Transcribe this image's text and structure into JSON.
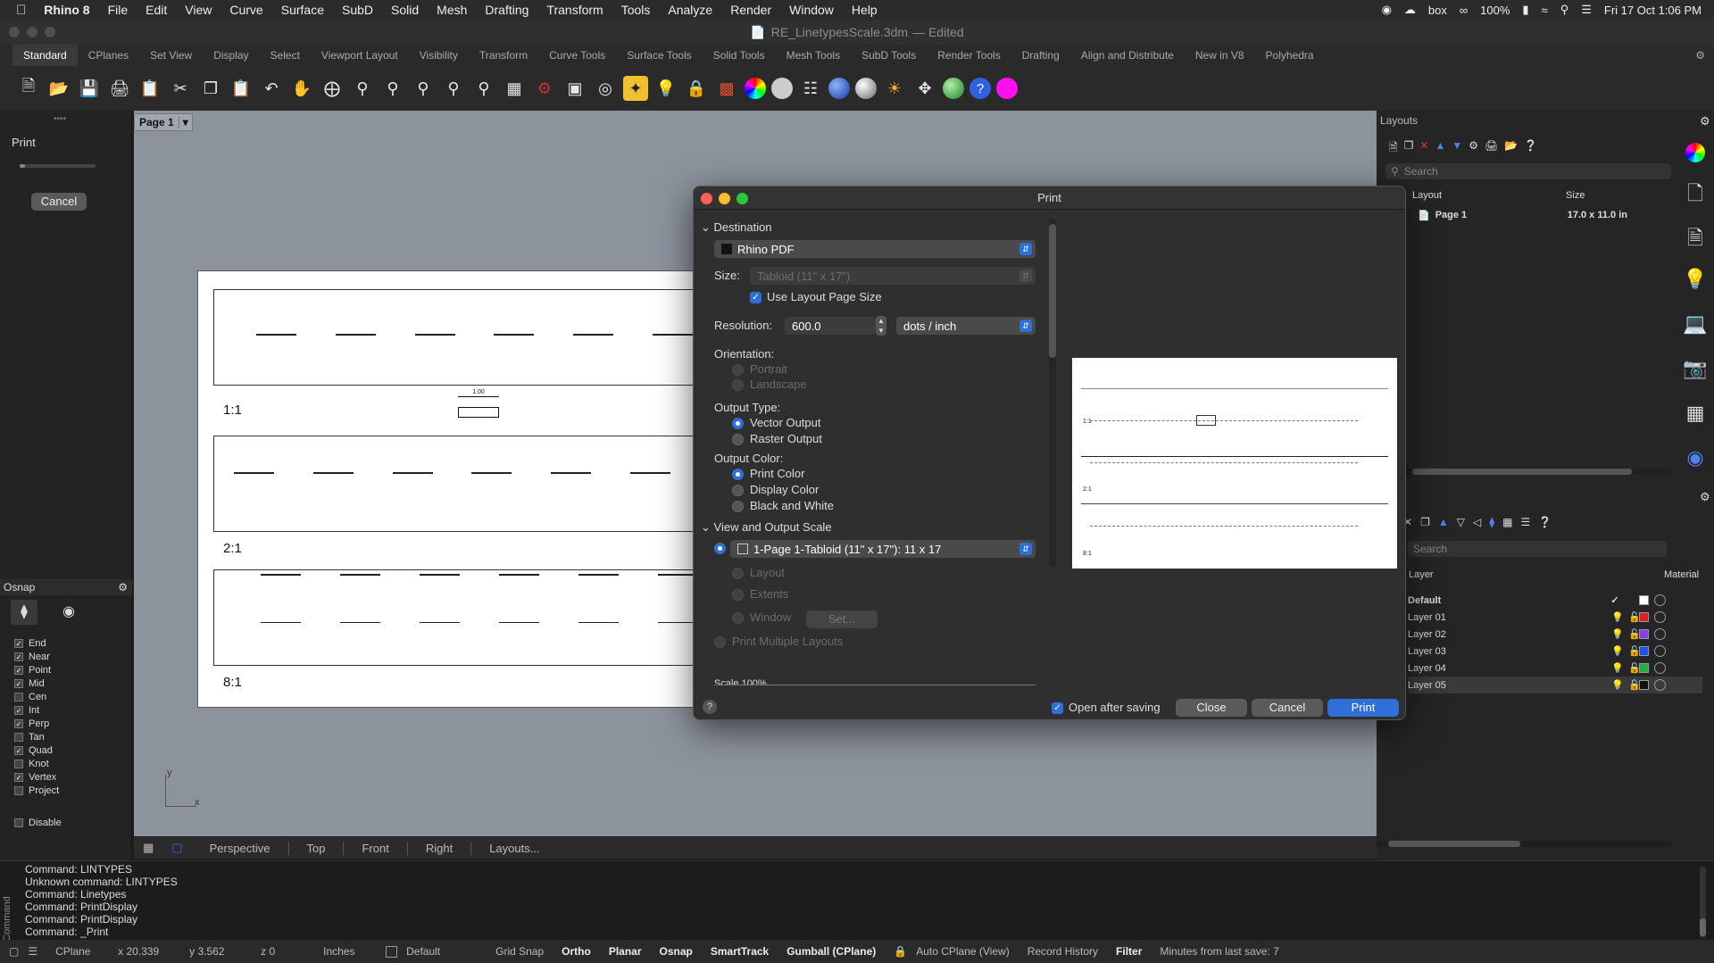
{
  "menubar": {
    "app_name": "Rhino 8",
    "items": [
      "File",
      "Edit",
      "View",
      "Curve",
      "Surface",
      "SubD",
      "Solid",
      "Mesh",
      "Drafting",
      "Transform",
      "Tools",
      "Analyze",
      "Render",
      "Window",
      "Help"
    ],
    "battery": "100%",
    "datetime": "Fri 17 Oct  1:06 PM"
  },
  "window": {
    "title": "RE_LinetypesScale.3dm",
    "edited": "— Edited"
  },
  "tabs": [
    "Standard",
    "CPlanes",
    "Set View",
    "Display",
    "Select",
    "Viewport Layout",
    "Visibility",
    "Transform",
    "Curve Tools",
    "Surface Tools",
    "Solid Tools",
    "Mesh Tools",
    "SubD Tools",
    "Render Tools",
    "Drafting",
    "Align and Distribute",
    "New in V8",
    "Polyhedra"
  ],
  "toolbar_icons": [
    "new-icon",
    "open-icon",
    "save-icon",
    "print-icon",
    "paste-special-icon",
    "cut-icon",
    "copy-icon",
    "paste-icon",
    "undo-icon",
    "pan-icon",
    "rotate-icon",
    "zoom-icon",
    "zoom-window-icon",
    "zoom-extents-icon",
    "zoom-selected-icon",
    "zoom-all-icon",
    "viewport-layout-icon",
    "car-icon",
    "plane-icon",
    "snap-icon",
    "object-snap-icon",
    "light-icon",
    "lock-icon",
    "properties-icon",
    "color-wheel-icon",
    "material-icon",
    "wireframe-icon",
    "shaded-icon",
    "rendered-icon",
    "sun-icon",
    "settings-icon",
    "transform-icon",
    "globe-icon",
    "help-icon",
    "magenta-icon"
  ],
  "left": {
    "print_label": "Print",
    "cancel_label": "Cancel",
    "osnap_title": "Osnap",
    "osnaps": [
      {
        "name": "End",
        "on": true
      },
      {
        "name": "Near",
        "on": true
      },
      {
        "name": "Point",
        "on": true
      },
      {
        "name": "Mid",
        "on": true
      },
      {
        "name": "Cen",
        "on": false
      },
      {
        "name": "Int",
        "on": true
      },
      {
        "name": "Perp",
        "on": true
      },
      {
        "name": "Tan",
        "on": false
      },
      {
        "name": "Quad",
        "on": true
      },
      {
        "name": "Knot",
        "on": false
      },
      {
        "name": "Vertex",
        "on": true
      },
      {
        "name": "Project",
        "on": false
      }
    ],
    "disable_label": "Disable"
  },
  "viewport": {
    "page_tab": "Page 1",
    "labels": [
      "1:1",
      "2:1",
      "8:1"
    ],
    "dimension": "1.00",
    "axis_x": "x",
    "axis_y": "y"
  },
  "view_tabs": [
    "Perspective",
    "Top",
    "Front",
    "Right",
    "Layouts..."
  ],
  "dialog": {
    "title": "Print",
    "destination_section": "Destination",
    "destination": "Rhino PDF",
    "size_label": "Size:",
    "size_value": "Tabloid (11\" x 17\")",
    "use_layout_size": "Use Layout Page Size",
    "resolution_label": "Resolution:",
    "resolution_value": "600.0",
    "resolution_unit": "dots / inch",
    "orientation_label": "Orientation:",
    "portrait": "Portrait",
    "landscape": "Landscape",
    "output_type_label": "Output Type:",
    "vector": "Vector Output",
    "raster": "Raster Output",
    "output_color_label": "Output Color:",
    "print_color": "Print Color",
    "display_color": "Display Color",
    "bw": "Black and White",
    "view_section": "View and Output Scale",
    "view_value": "1-Page 1-Tabloid (11\" x 17\"): 11 x 17",
    "layout": "Layout",
    "extents": "Extents",
    "window": "Window",
    "set_label": "Set...",
    "multiple_layouts": "Print Multiple Layouts",
    "scale_label": "Scale 100%",
    "open_after_saving": "Open after saving",
    "close_label": "Close",
    "cancel_label": "Cancel",
    "print_label": "Print",
    "preview_labels": [
      "1:1",
      "2:1",
      "8:1"
    ]
  },
  "layouts_panel": {
    "title": "Layouts",
    "search_placeholder": "Search",
    "col_layout": "Layout",
    "col_size": "Size",
    "rows": [
      {
        "name": "Page 1",
        "size": "17.0 x 11.0 in"
      }
    ]
  },
  "layers_panel": {
    "search_placeholder": "Search",
    "col_layer": "Layer",
    "col_material": "Material",
    "rows": [
      {
        "name": "Default",
        "color": "#ffffff",
        "current": true
      },
      {
        "name": "Layer 01",
        "color": "#e02020"
      },
      {
        "name": "Layer 02",
        "color": "#8a3cf0"
      },
      {
        "name": "Layer 03",
        "color": "#2050f0"
      },
      {
        "name": "Layer 04",
        "color": "#20b040"
      },
      {
        "name": "Layer 05",
        "color": "#111111"
      }
    ]
  },
  "command_lines": [
    "Command: LINTYPES",
    "Unknown command: LINTYPES",
    "Command: Linetypes",
    "Command: PrintDisplay",
    "Command: PrintDisplay",
    "Command: _Print"
  ],
  "command_side_label": "Command",
  "status": {
    "cplane": "CPlane",
    "x": "x 20.339",
    "y": "y 3.562",
    "z": "z 0",
    "units": "Inches",
    "layer": "Default",
    "items": [
      "Grid Snap",
      "Ortho",
      "Planar",
      "Osnap",
      "SmartTrack",
      "Gumball (CPlane)",
      "Auto CPlane (View)",
      "Record History",
      "Filter"
    ],
    "minutes": "Minutes from last save: 7"
  }
}
